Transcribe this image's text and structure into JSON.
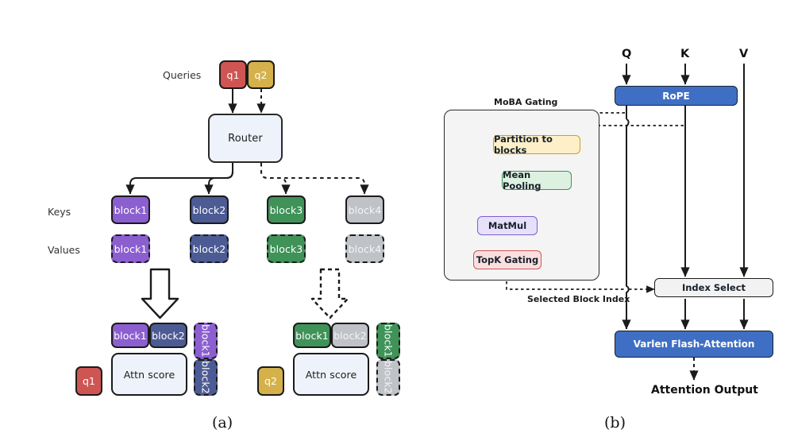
{
  "figure": {
    "caption_a": "(a)",
    "caption_b": "(b)"
  },
  "panel_a": {
    "row_labels": {
      "queries": "Queries",
      "keys": "Keys",
      "values": "Values"
    },
    "queries": [
      {
        "label": "q1",
        "color": "#cf5553"
      },
      {
        "label": "q2",
        "color": "#d4b14a"
      }
    ],
    "router": {
      "label": "Router",
      "fill": "#eef2fa"
    },
    "keys": [
      {
        "label": "block1",
        "color": "#8b5fd0"
      },
      {
        "label": "block2",
        "color": "#4c5b94"
      },
      {
        "label": "block3",
        "color": "#3f9258"
      },
      {
        "label": "block4",
        "color": "#bfc2c7"
      }
    ],
    "values": [
      {
        "label": "block1",
        "color": "#8b5fd0"
      },
      {
        "label": "block2",
        "color": "#4c5b94"
      },
      {
        "label": "block3",
        "color": "#3f9258"
      },
      {
        "label": "block4",
        "color": "#bfc2c7"
      }
    ],
    "result_left": {
      "query": {
        "label": "q1",
        "color": "#cf5553"
      },
      "attn_label": "Attn score",
      "top_blocks": [
        {
          "label": "block1",
          "color": "#8b5fd0"
        },
        {
          "label": "block2",
          "color": "#4c5b94"
        }
      ],
      "side_blocks": [
        {
          "label": "block1",
          "color": "#8b5fd0"
        },
        {
          "label": "block2",
          "color": "#4c5b94"
        }
      ]
    },
    "result_right": {
      "query": {
        "label": "q2",
        "color": "#d4b14a"
      },
      "attn_label": "Attn score",
      "top_blocks": [
        {
          "label": "block1",
          "color": "#3f9258"
        },
        {
          "label": "block2",
          "color": "#bfc2c7"
        }
      ],
      "side_blocks": [
        {
          "label": "block1",
          "color": "#3f9258"
        },
        {
          "label": "block2",
          "color": "#bfc2c7"
        }
      ]
    }
  },
  "panel_b": {
    "inputs": {
      "q": "Q",
      "k": "K",
      "v": "V"
    },
    "rope": {
      "label": "RoPE",
      "color": "#3f6fc4"
    },
    "gating": {
      "title": "MoBA Gating",
      "steps": [
        {
          "label": "Partition to blocks",
          "fill": "#fdefc8",
          "border": "#c9a227"
        },
        {
          "label": "Mean Pooling",
          "fill": "#ddf1e0",
          "border": "#3f9258"
        },
        {
          "label": "MatMul",
          "fill": "#e7e0fb",
          "border": "#7b5fd0"
        },
        {
          "label": "TopK Gating",
          "fill": "#fbdfe0",
          "border": "#cf5553"
        }
      ]
    },
    "selected_block_index": "Selected Block Index",
    "index_select": {
      "label": "Index Select",
      "fill": "#f2f2f2"
    },
    "flash_attention": {
      "label": "Varlen Flash-Attention",
      "color": "#3f6fc4"
    },
    "output": "Attention Output"
  }
}
